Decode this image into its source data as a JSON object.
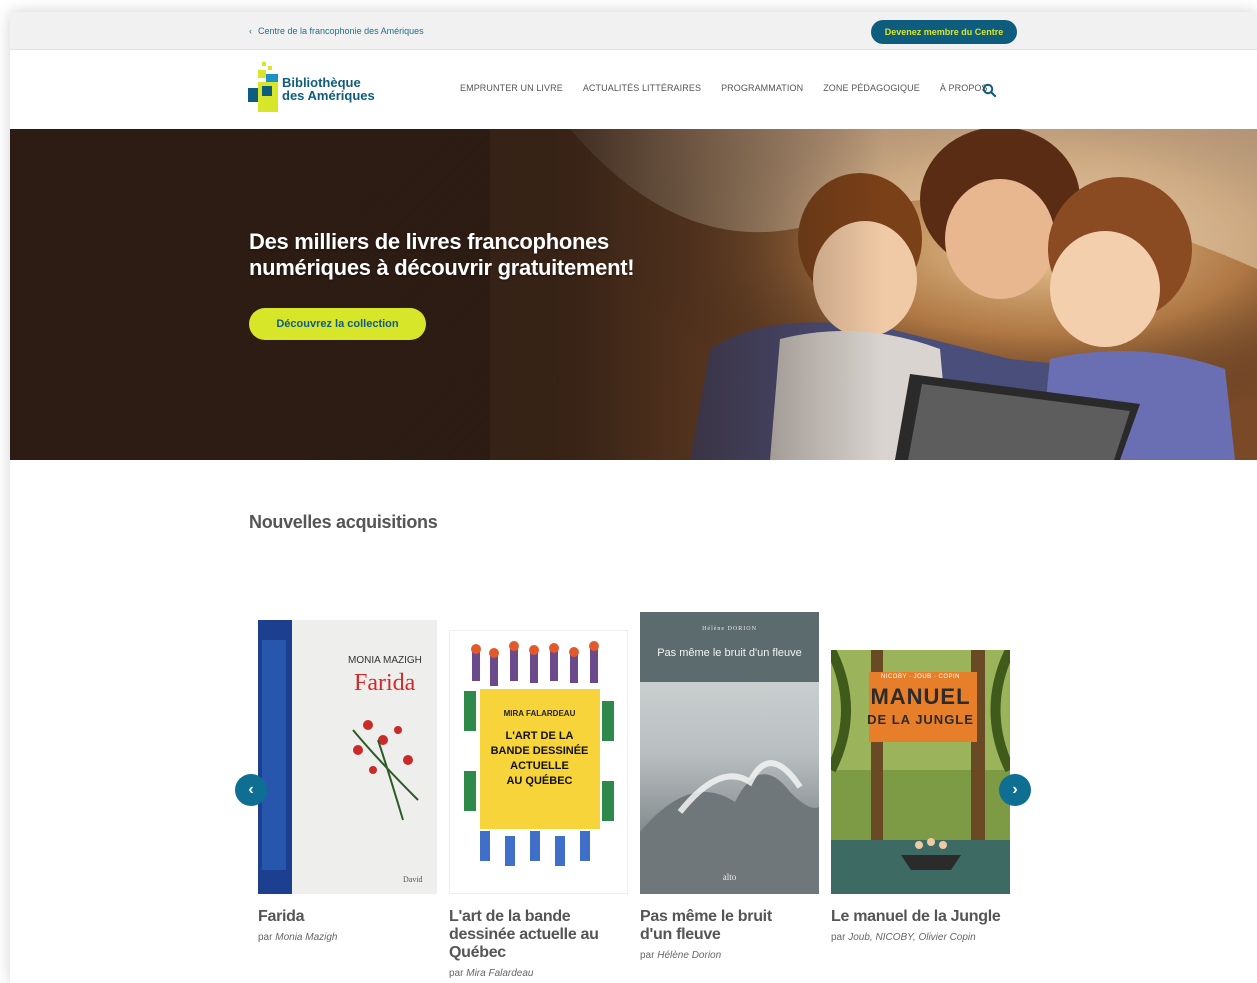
{
  "topbar": {
    "back_link": "Centre de la francophonie des Amériques",
    "join_button": "Devenez membre du Centre"
  },
  "logo": {
    "line1": "Bibliothèque",
    "line2": "des Amériques"
  },
  "nav": {
    "items": [
      {
        "label": "EMPRUNTER UN LIVRE"
      },
      {
        "label": "ACTUALITÉS LITTÉRAIRES"
      },
      {
        "label": "PROGRAMMATION"
      },
      {
        "label": "ZONE PÉDAGOGIQUE"
      },
      {
        "label": "À PROPOS"
      }
    ],
    "search_icon": "search-icon"
  },
  "hero": {
    "title_line1": "Des milliers de livres francophones",
    "title_line2": "numériques à découvrir gratuitement!",
    "cta": "Découvrez la collection"
  },
  "section": {
    "title": "Nouvelles acquisitions"
  },
  "books": [
    {
      "title": "Farida",
      "by": "par",
      "author": "Monia Mazigh",
      "cover_author": "MONIA MAZIGH",
      "cover_title": "Farida",
      "cover_publisher": "David"
    },
    {
      "title_line1": "L'art de la bande",
      "title_line2": "dessinée actuelle au",
      "title_line3": "Québec",
      "by": "par",
      "author": "Mira Falardeau",
      "cover_author": "MIRA FALARDEAU",
      "cover_title1": "L'ART DE LA",
      "cover_title2": "BANDE DESSINÉE",
      "cover_title3": "ACTUELLE",
      "cover_title4": "AU QUÉBEC"
    },
    {
      "title_line1": "Pas même le bruit",
      "title_line2": "d'un fleuve",
      "by": "par",
      "author": "Hélène Dorion",
      "cover_author": "Hélène DORION",
      "cover_title": "Pas même le bruit d'un fleuve",
      "cover_publisher": "alto"
    },
    {
      "title": "Le manuel de la Jungle",
      "by": "par",
      "author": "Joub, NICOBY, Olivier Copin",
      "cover_authors": "NICOBY · JOUB · COPIN",
      "cover_title1": "MANUEL",
      "cover_title2": "DE LA JUNGLE"
    }
  ],
  "colors": {
    "brand_blue": "#0e5c7e",
    "accent_lime": "#d8e62a"
  }
}
